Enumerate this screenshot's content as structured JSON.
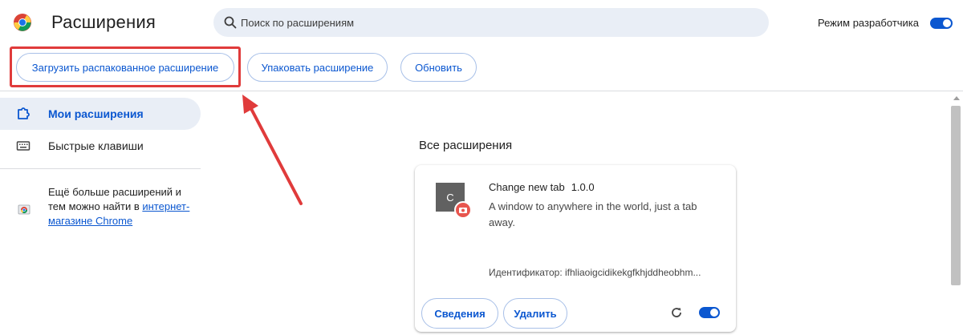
{
  "header": {
    "title": "Расширения",
    "search_placeholder": "Поиск по расширениям",
    "dev_mode_label": "Режим разработчика",
    "dev_mode_on": true
  },
  "toolbar": {
    "load_unpacked_label": "Загрузить распакованное расширение",
    "pack_label": "Упаковать расширение",
    "update_label": "Обновить"
  },
  "sidebar": {
    "items": [
      {
        "label": "Мои расширения",
        "icon": "puzzle-icon",
        "active": true
      },
      {
        "label": "Быстрые клавиши",
        "icon": "keyboard-icon",
        "active": false
      }
    ],
    "store_text_line1": "Ещё больше расширений и тем можно найти в",
    "store_link": "интернет-магазине Chrome"
  },
  "main": {
    "section_title": "Все расширения",
    "extensions": [
      {
        "icon_letter": "C",
        "name": "Change new tab",
        "version": "1.0.0",
        "description": "A window to anywhere in the world, just a tab away.",
        "id_text": "Идентификатор: ifhliaoigcidikekgfkhjddheobhm...",
        "details_label": "Сведения",
        "remove_label": "Удалить",
        "enabled": true
      }
    ]
  },
  "colors": {
    "accent": "#0b57d0",
    "highlight": "#e03b3b",
    "search_bg": "#e9eef6"
  }
}
